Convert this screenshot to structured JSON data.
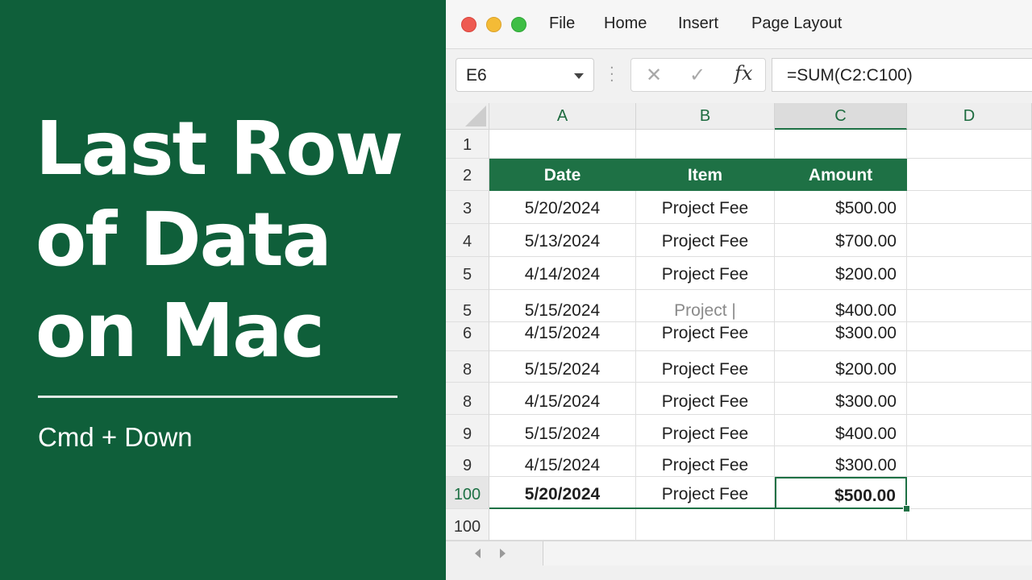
{
  "banner": {
    "title_lines": [
      "Last Row",
      "of Data",
      "on Mac"
    ],
    "shortcut": "Cmd + Down",
    "bg_color": "#0f5f3a"
  },
  "window": {
    "menu": [
      "File",
      "Home",
      "Insert",
      "Page Layout"
    ],
    "name_box": "E6",
    "formula_cancel_icon": "✕",
    "formula_enter_icon": "✓",
    "formula_fx": "fx",
    "formula": "=SUM(C2:C100)",
    "accent_color": "#1e7145"
  },
  "grid": {
    "columns": [
      "A",
      "B",
      "C",
      "D"
    ],
    "rows": [
      {
        "num": "1",
        "cells": [
          "",
          "",
          ""
        ]
      },
      {
        "num": "2",
        "cells": [
          "Date",
          "Item",
          "Amount"
        ]
      },
      {
        "num": "3",
        "cells": [
          "5/20/2024",
          "Project Fee",
          "$500.00"
        ]
      },
      {
        "num": "4",
        "cells": [
          "5/13/2024",
          "Project Fee",
          "$700.00"
        ]
      },
      {
        "num": "5",
        "cells": [
          "4/14/2024",
          "Project Fee",
          "$200.00"
        ]
      },
      {
        "num": "5",
        "cells": [
          "5/15/2024",
          "Project |",
          "$400.00"
        ]
      },
      {
        "num": "6",
        "cells": [
          "4/15/2024",
          "Project Fee",
          "$300.00"
        ]
      },
      {
        "num": "8",
        "cells": [
          "5/15/2024",
          "Project Fee",
          "$200.00"
        ]
      },
      {
        "num": "8",
        "cells": [
          "4/15/2024",
          "Project Fee",
          "$300.00"
        ]
      },
      {
        "num": "9",
        "cells": [
          "5/15/2024",
          "Project Fee",
          "$400.00"
        ]
      },
      {
        "num": "9",
        "cells": [
          "4/15/2024",
          "Project Fee",
          "$300.00"
        ]
      },
      {
        "num": "100",
        "cells": [
          "5/20/2024",
          "Project Fee",
          "$500.00"
        ]
      },
      {
        "num": "100",
        "cells": [
          "",
          "",
          ""
        ]
      }
    ]
  }
}
